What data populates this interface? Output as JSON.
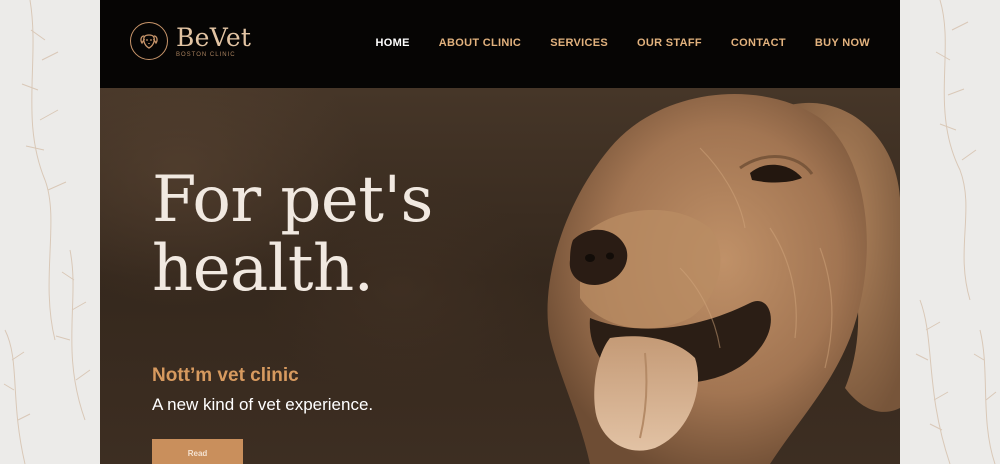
{
  "colors": {
    "accent": "#c98f5c",
    "accent_light": "#e2b27e",
    "header_background": "#060504",
    "page_background": "#ecebe9",
    "hero_title": "#f1e9e1"
  },
  "brand": {
    "name": "BeVet",
    "subtitle": "BOSTON CLINIC",
    "logo_icon": "dog-face-icon"
  },
  "nav": {
    "items": [
      {
        "label": "HOME",
        "active": true
      },
      {
        "label": "ABOUT CLINIC",
        "active": false
      },
      {
        "label": "SERVICES",
        "active": false
      },
      {
        "label": "OUR STAFF",
        "active": false
      },
      {
        "label": "CONTACT",
        "active": false
      },
      {
        "label": "BUY NOW",
        "active": false
      }
    ]
  },
  "hero": {
    "title_line1": "For pet's",
    "title_line2": "health.",
    "subtitle": "Nott’m vet clinic",
    "tagline": "A new kind of vet experience.",
    "button_label": "Read"
  }
}
